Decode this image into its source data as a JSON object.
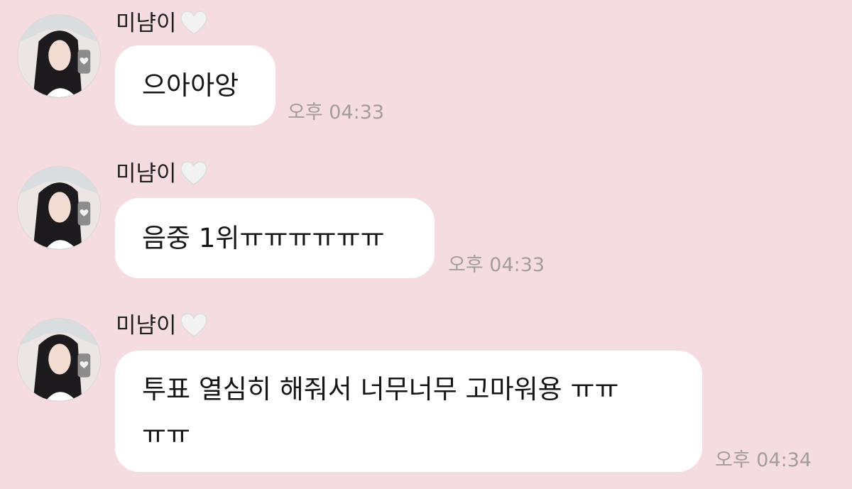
{
  "theme": {
    "background": "#f5dce1",
    "bubble": "#ffffff",
    "timestamp_color": "#a39c9d"
  },
  "messages": [
    {
      "sender": "미냠이",
      "sender_icon": "white-heart-icon",
      "lines": [
        "으아아앙"
      ],
      "time": "오후 04:33"
    },
    {
      "sender": "미냠이",
      "sender_icon": "white-heart-icon",
      "lines": [
        "음중 1위ㅠㅠㅠㅠㅠㅠ"
      ],
      "time": "오후 04:33"
    },
    {
      "sender": "미냠이",
      "sender_icon": "white-heart-icon",
      "lines": [
        "투표 열심히 해줘서 너무너무 고마워용 ㅠㅠ",
        "ㅠㅠ"
      ],
      "time": "오후 04:34"
    }
  ]
}
